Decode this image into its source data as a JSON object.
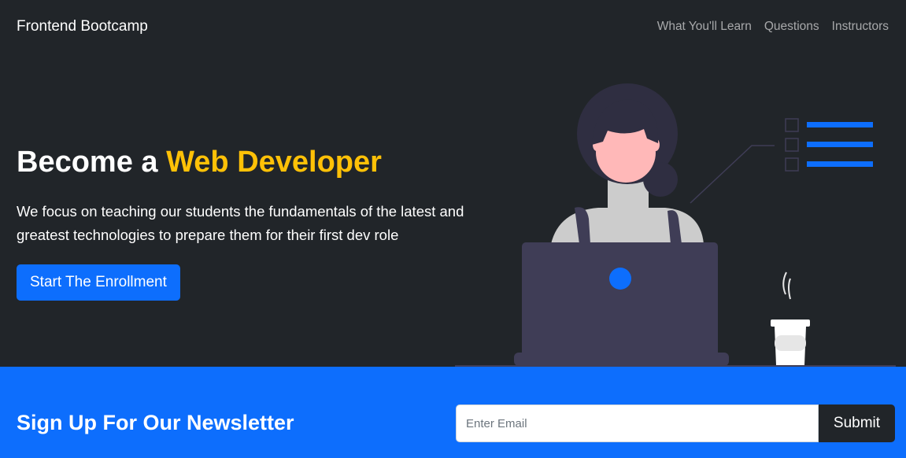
{
  "navbar": {
    "brand": "Frontend Bootcamp",
    "links": [
      {
        "label": "What You'll Learn"
      },
      {
        "label": "Questions"
      },
      {
        "label": "Instructors"
      }
    ]
  },
  "hero": {
    "title_prefix": "Become a",
    "title_accent": "Web Developer",
    "lead": "We focus on teaching our students the fundamentals of the latest and greatest technologies to prepare them for their first dev role",
    "cta_label": "Start The Enrollment"
  },
  "newsletter": {
    "title": "Sign Up For Our Newsletter",
    "email_placeholder": "Enter Email",
    "email_value": "",
    "submit_label": "Submit"
  },
  "colors": {
    "background": "#212529",
    "accent": "#ffc107",
    "primary": "#0d6efd",
    "laptop": "#3f3d56",
    "skin": "#ffb8b8"
  },
  "icons": [
    "checkbox-icon",
    "list-line-icon",
    "laptop-logo-icon"
  ]
}
